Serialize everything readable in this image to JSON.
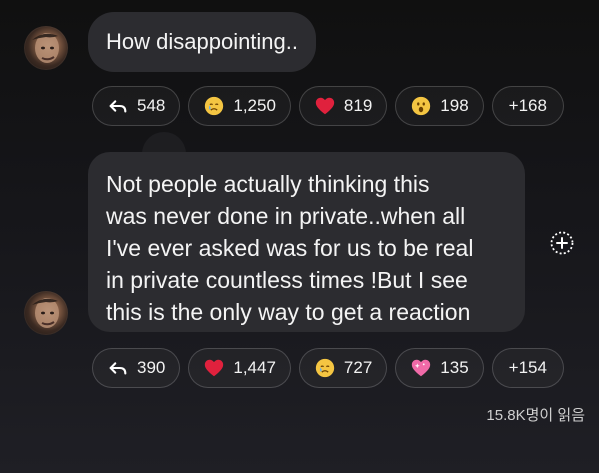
{
  "messages": [
    {
      "text": "How disappointing..",
      "reactions": [
        {
          "icon": "reply-arrow-icon",
          "count": "548"
        },
        {
          "icon": "crying-face-icon",
          "count": "1,250"
        },
        {
          "icon": "red-heart-icon",
          "count": "819"
        },
        {
          "icon": "surprised-face-icon",
          "count": "198"
        },
        {
          "icon": "more-reactions",
          "count": "+168"
        }
      ]
    },
    {
      "lines": [
        "Not people actually thinking this",
        "was never done in private..when all",
        "I've ever asked was for us to be real",
        "in private countless times !But I see",
        "this is the only way to get a reaction"
      ],
      "reactions": [
        {
          "icon": "reply-arrow-icon",
          "count": "390"
        },
        {
          "icon": "red-heart-icon",
          "count": "1,447"
        },
        {
          "icon": "crying-face-icon",
          "count": "727"
        },
        {
          "icon": "sparkling-heart-icon",
          "count": "135"
        },
        {
          "icon": "more-reactions",
          "count": "+154"
        }
      ]
    }
  ],
  "footer": {
    "read_count": "15.8K명이 읽음"
  },
  "colors": {
    "bubble": "#2c2c30",
    "text": "#f4f4f4",
    "heart": "#e0213d",
    "emoji": "#f4c542",
    "pink_heart": "#f06aa8"
  }
}
